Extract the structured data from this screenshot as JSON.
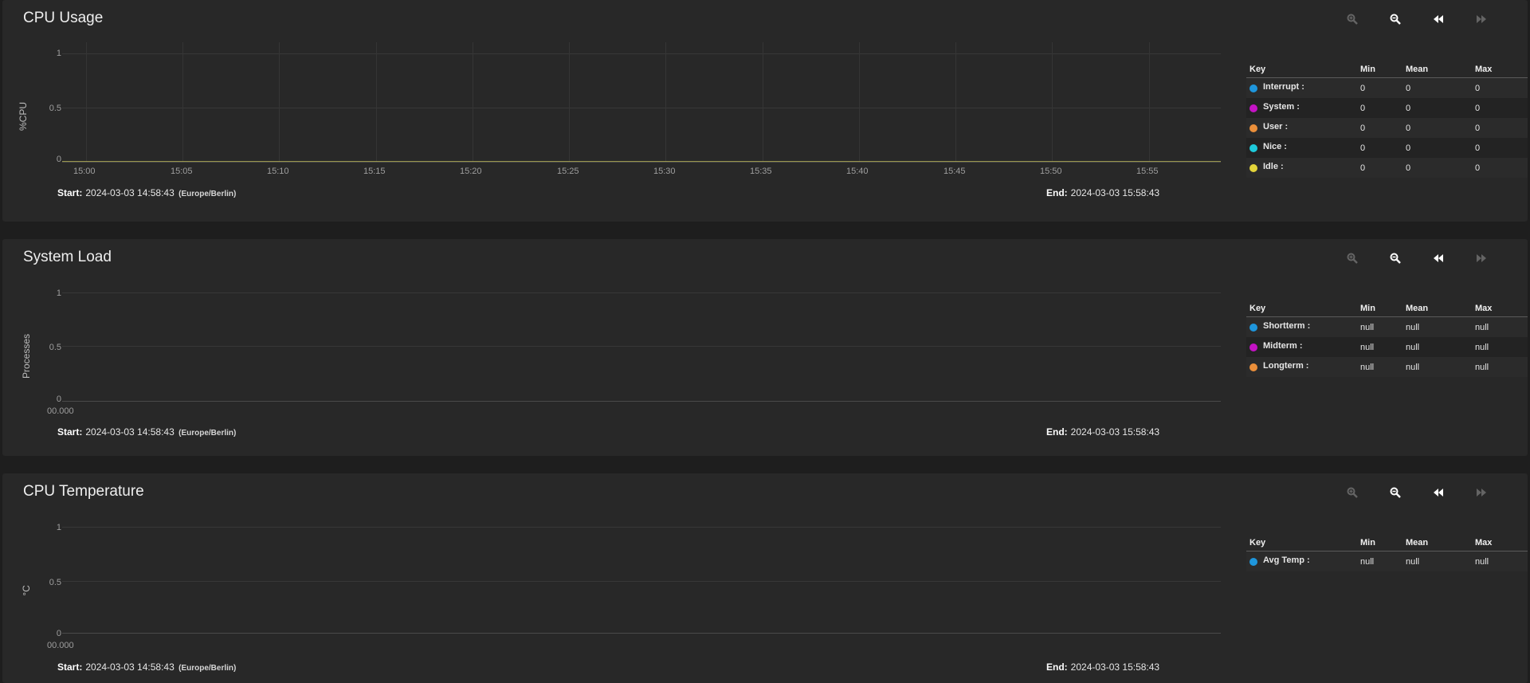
{
  "colors": {
    "blue": "#1e96dc",
    "magenta": "#c413c4",
    "orange": "#eb8f3a",
    "cyan": "#1ecadb",
    "yellow": "#e3d43a"
  },
  "icons": {
    "zoom_in": "zoom-in-icon",
    "zoom_out": "zoom-out-icon",
    "step_back": "rewind-icon",
    "step_forward": "fast-forward-icon"
  },
  "legend_header": {
    "key": "Key",
    "min": "Min",
    "mean": "Mean",
    "max": "Max"
  },
  "footer": {
    "start_label": "Start:",
    "end_label": "End:",
    "start_value": "2024-03-03 14:58:43",
    "timezone": "(Europe/Berlin)",
    "end_value": "2024-03-03 15:58:43"
  },
  "cpu_usage": {
    "title": "CPU Usage",
    "y_label": "%CPU",
    "y_ticks": [
      "1",
      "0.5",
      "0"
    ],
    "x_ticks": [
      "15:00",
      "15:05",
      "15:10",
      "15:15",
      "15:20",
      "15:25",
      "15:30",
      "15:35",
      "15:40",
      "15:45",
      "15:50",
      "15:55"
    ],
    "legend": [
      {
        "key": "Interrupt :",
        "min": "0",
        "mean": "0",
        "max": "0",
        "color": "#1e96dc"
      },
      {
        "key": "System :",
        "min": "0",
        "mean": "0",
        "max": "0",
        "color": "#c413c4"
      },
      {
        "key": "User :",
        "min": "0",
        "mean": "0",
        "max": "0",
        "color": "#eb8f3a"
      },
      {
        "key": "Nice :",
        "min": "0",
        "mean": "0",
        "max": "0",
        "color": "#1ecadb"
      },
      {
        "key": "Idle :",
        "min": "0",
        "mean": "0",
        "max": "0",
        "color": "#e3d43a"
      }
    ]
  },
  "system_load": {
    "title": "System Load",
    "y_label": "Processes",
    "y_ticks": [
      "1",
      "0.5",
      "0"
    ],
    "x_ticks": [
      "00.000"
    ],
    "legend": [
      {
        "key": "Shortterm :",
        "min": "null",
        "mean": "null",
        "max": "null",
        "color": "#1e96dc"
      },
      {
        "key": "Midterm :",
        "min": "null",
        "mean": "null",
        "max": "null",
        "color": "#c413c4"
      },
      {
        "key": "Longterm :",
        "min": "null",
        "mean": "null",
        "max": "null",
        "color": "#eb8f3a"
      }
    ]
  },
  "cpu_temperature": {
    "title": "CPU Temperature",
    "y_label": "°C",
    "y_ticks": [
      "1",
      "0.5",
      "0"
    ],
    "x_ticks": [
      "00.000"
    ],
    "legend": [
      {
        "key": "Avg Temp :",
        "min": "null",
        "mean": "null",
        "max": "null",
        "color": "#1e96dc"
      }
    ]
  }
}
